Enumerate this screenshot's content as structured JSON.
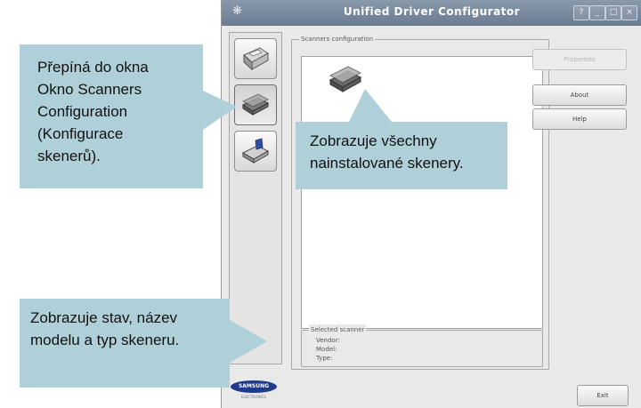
{
  "window": {
    "title": "Unified Driver Configurator",
    "controls": [
      "?",
      "_",
      "□",
      "×"
    ]
  },
  "nav": [
    {
      "id": "printers",
      "icon": "printer-icon",
      "active": false
    },
    {
      "id": "scanners",
      "icon": "scanner-icon",
      "active": true
    },
    {
      "id": "ports",
      "icon": "port-icon",
      "active": false
    }
  ],
  "scanners_group": {
    "label": "Scanners configuration"
  },
  "buttons": {
    "properties": "Properties",
    "about": "About",
    "help": "Help",
    "exit": "Exit"
  },
  "selected_scanner": {
    "label": "Selected scanner",
    "vendor_label": "Vendor:",
    "model_label": "Model:",
    "type_label": "Type:"
  },
  "logo": {
    "brand": "SAMSUNG",
    "sub": "ELECTRONICS"
  },
  "callouts": {
    "nav": [
      "Přepíná do okna",
      "Okno Scanners",
      "Configuration",
      "(Konfigurace",
      "skenerů)."
    ],
    "list": [
      "Zobrazuje všechny",
      "nainstalované skenery."
    ],
    "selected": [
      "Zobrazuje stav, název",
      "modelu a typ skeneru."
    ]
  },
  "colors": {
    "callout_bg": "#afd0d9",
    "titlebar": "#7a8a9e"
  }
}
